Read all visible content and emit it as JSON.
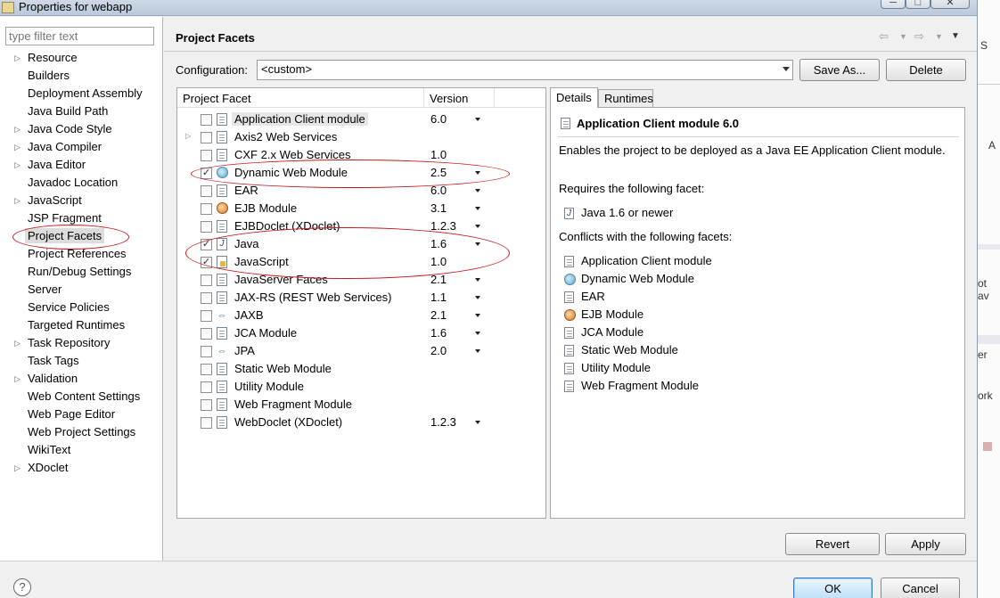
{
  "window": {
    "title": "Properties for webapp",
    "min_glyph": "─",
    "max_glyph": "□",
    "close_glyph": "✕"
  },
  "filter": {
    "placeholder": "type filter text"
  },
  "nav": {
    "items": [
      {
        "label": "Resource",
        "expandable": true
      },
      {
        "label": "Builders",
        "expandable": false
      },
      {
        "label": "Deployment Assembly",
        "expandable": false
      },
      {
        "label": "Java Build Path",
        "expandable": false
      },
      {
        "label": "Java Code Style",
        "expandable": true
      },
      {
        "label": "Java Compiler",
        "expandable": true
      },
      {
        "label": "Java Editor",
        "expandable": true
      },
      {
        "label": "Javadoc Location",
        "expandable": false
      },
      {
        "label": "JavaScript",
        "expandable": true
      },
      {
        "label": "JSP Fragment",
        "expandable": false
      },
      {
        "label": "Project Facets",
        "expandable": false,
        "selected": true
      },
      {
        "label": "Project References",
        "expandable": false
      },
      {
        "label": "Run/Debug Settings",
        "expandable": false
      },
      {
        "label": "Server",
        "expandable": false
      },
      {
        "label": "Service Policies",
        "expandable": false
      },
      {
        "label": "Targeted Runtimes",
        "expandable": false
      },
      {
        "label": "Task Repository",
        "expandable": true
      },
      {
        "label": "Task Tags",
        "expandable": false
      },
      {
        "label": "Validation",
        "expandable": true
      },
      {
        "label": "Web Content Settings",
        "expandable": false
      },
      {
        "label": "Web Page Editor",
        "expandable": false
      },
      {
        "label": "Web Project Settings",
        "expandable": false
      },
      {
        "label": "WikiText",
        "expandable": false
      },
      {
        "label": "XDoclet",
        "expandable": true
      }
    ]
  },
  "page": {
    "title": "Project Facets",
    "header_icons": [
      "back-arrow-icon",
      "chevron-down-icon",
      "forward-arrow-icon",
      "chevron-down-icon",
      "view-menu-icon"
    ]
  },
  "config": {
    "label": "Configuration:",
    "value": "<custom>",
    "save_as": "Save As...",
    "delete": "Delete"
  },
  "facet_table": {
    "col_facet": "Project Facet",
    "col_version": "Version",
    "rows": [
      {
        "name": "Application Client module",
        "version": "6.0",
        "checked": false,
        "icon": "doc",
        "has_dropdown": true,
        "selected": true
      },
      {
        "name": "Axis2 Web Services",
        "version": "",
        "checked": false,
        "icon": "doc",
        "has_dropdown": false,
        "expandable": true
      },
      {
        "name": "CXF 2.x Web Services",
        "version": "1.0",
        "checked": false,
        "icon": "doc",
        "has_dropdown": false
      },
      {
        "name": "Dynamic Web Module",
        "version": "2.5",
        "checked": true,
        "icon": "globe",
        "has_dropdown": true
      },
      {
        "name": "EAR",
        "version": "6.0",
        "checked": false,
        "icon": "doc",
        "has_dropdown": true
      },
      {
        "name": "EJB Module",
        "version": "3.1",
        "checked": false,
        "icon": "bean",
        "has_dropdown": true
      },
      {
        "name": "EJBDoclet (XDoclet)",
        "version": "1.2.3",
        "checked": false,
        "icon": "doc",
        "has_dropdown": true
      },
      {
        "name": "Java",
        "version": "1.6",
        "checked": true,
        "icon": "java",
        "has_dropdown": true
      },
      {
        "name": "JavaScript",
        "version": "1.0",
        "checked": true,
        "icon": "js",
        "has_dropdown": false
      },
      {
        "name": "JavaServer Faces",
        "version": "2.1",
        "checked": false,
        "icon": "doc",
        "has_dropdown": true
      },
      {
        "name": "JAX-RS (REST Web Services)",
        "version": "1.1",
        "checked": false,
        "icon": "doc",
        "has_dropdown": true
      },
      {
        "name": "JAXB",
        "version": "2.1",
        "checked": false,
        "icon": "ws",
        "has_dropdown": true
      },
      {
        "name": "JCA Module",
        "version": "1.6",
        "checked": false,
        "icon": "doc",
        "has_dropdown": true
      },
      {
        "name": "JPA",
        "version": "2.0",
        "checked": false,
        "icon": "ws",
        "has_dropdown": true
      },
      {
        "name": "Static Web Module",
        "version": "",
        "checked": false,
        "icon": "doc",
        "has_dropdown": false
      },
      {
        "name": "Utility Module",
        "version": "",
        "checked": false,
        "icon": "doc",
        "has_dropdown": false
      },
      {
        "name": "Web Fragment Module",
        "version": "",
        "checked": false,
        "icon": "doc",
        "has_dropdown": false
      },
      {
        "name": "WebDoclet (XDoclet)",
        "version": "1.2.3",
        "checked": false,
        "icon": "doc",
        "has_dropdown": true
      }
    ]
  },
  "details": {
    "tab_details": "Details",
    "tab_runtimes": "Runtimes",
    "title": "Application Client module 6.0",
    "description": "Enables the project to be deployed as a Java EE Application Client module.",
    "requires_label": "Requires the following facet:",
    "requires": [
      {
        "label": "Java 1.6 or newer",
        "icon": "java"
      }
    ],
    "conflicts_label": "Conflicts with the following facets:",
    "conflicts": [
      {
        "label": "Application Client module",
        "icon": "doc"
      },
      {
        "label": "Dynamic Web Module",
        "icon": "globe"
      },
      {
        "label": "EAR",
        "icon": "doc"
      },
      {
        "label": "EJB Module",
        "icon": "bean"
      },
      {
        "label": "JCA Module",
        "icon": "doc"
      },
      {
        "label": "Static Web Module",
        "icon": "doc"
      },
      {
        "label": "Utility Module",
        "icon": "doc"
      },
      {
        "label": "Web Fragment Module",
        "icon": "doc"
      }
    ]
  },
  "buttons": {
    "revert": "Revert",
    "apply": "Apply",
    "ok": "OK",
    "cancel": "Cancel",
    "help": "?"
  },
  "background_window": {
    "fragments": [
      "S",
      "A",
      "ot av",
      "er",
      "ork"
    ]
  },
  "colors": {
    "annotation": "#c41a1a",
    "ok_accent": "#3b7bbf"
  }
}
